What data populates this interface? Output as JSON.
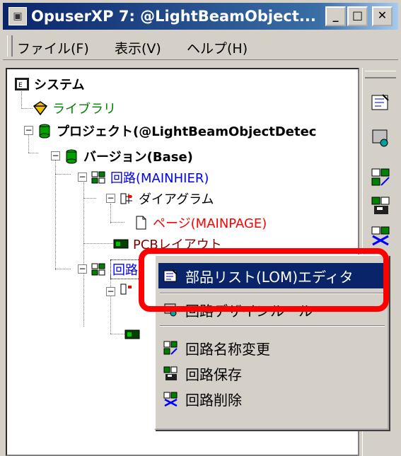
{
  "window": {
    "title": "OpuserXP 7: @LightBeamObject...",
    "minimize": "_",
    "maximize": "□",
    "close": "✕"
  },
  "menubar": {
    "items": [
      "ファイル(F)",
      "表示(V)",
      "ヘルプ(H)"
    ]
  },
  "tree": {
    "system": "システム",
    "library": "ライブラリ",
    "project": "プロジェクト(@LightBeamObjectDetec",
    "version": "バージョン(Base)",
    "circuit1": "回路(MAINHIER)",
    "diagram": "ダイアグラム",
    "page": "ページ(MAINPAGE)",
    "pcb": "PCBレイアウト",
    "circuit2": "回路"
  },
  "context_menu": {
    "items": [
      {
        "label": "部品リスト(LOM)エディタ",
        "icon": "lom-editor-icon",
        "selected": true
      },
      {
        "label": "回路デザインルール",
        "icon": "design-rule-icon"
      },
      {
        "label": "回路名称変更",
        "icon": "rename-circuit-icon"
      },
      {
        "label": "回路保存",
        "icon": "save-circuit-icon"
      },
      {
        "label": "回路削除",
        "icon": "delete-circuit-icon"
      }
    ]
  },
  "colors": {
    "library": "#008000",
    "circuit": "#0000ff",
    "page": "#ff0000",
    "pcb": "#800000",
    "highlight": "#ff0000",
    "selection": "#0a246a"
  }
}
